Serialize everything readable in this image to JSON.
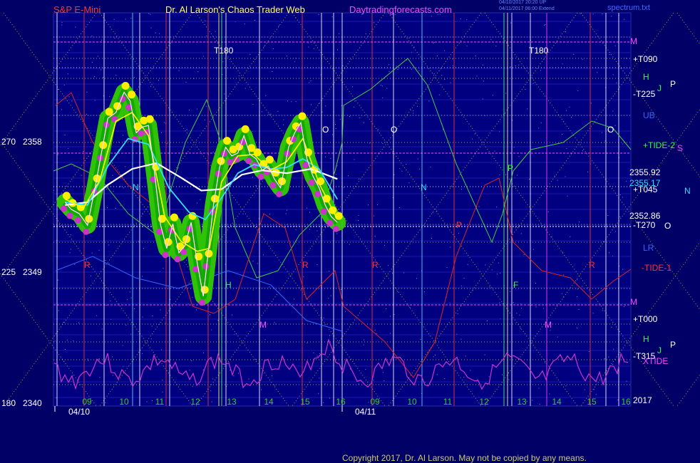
{
  "header": {
    "symbol": "S&P E-Mini",
    "site": "Dr. Al Larson's Chaos Trader Web",
    "url": "Daytradingforecasts.com",
    "stamp_line1": "04/10/2017 20:20 UP",
    "stamp_line2": "04/11/2017 06:00 Extend",
    "file": "spectrum.txt"
  },
  "copyright": "Copyright 2017, Dr. Al Larson. May not be copied by any means.",
  "colors": {
    "background": "#000066",
    "price_line": "#ffffff",
    "ma_fast": "#ffff00",
    "ma_mid": "#ff44ff",
    "ma_slow": "#33ddff",
    "ma_long": "#ffffff",
    "highlight_green": "#33cc00",
    "dot_yellow": "#ffee00",
    "dot_magenta": "#cc33cc",
    "tide": "#cc33cc",
    "red_flux": "#dd2222",
    "green_flux": "#44cc44"
  },
  "chart_data": {
    "type": "line",
    "title": "S&P E-Mini",
    "y_axis_labels": [
      {
        "angle": "270",
        "price": "2358"
      },
      {
        "angle": "225",
        "price": "2349"
      },
      {
        "angle": "180",
        "price": "2340"
      }
    ],
    "ylim": [
      2340,
      2365
    ],
    "dates": [
      "04/10",
      "04/11"
    ],
    "hour_ticks": [
      "09",
      "10",
      "11",
      "12",
      "13",
      "14",
      "15",
      "16",
      "09",
      "10",
      "11",
      "12",
      "13",
      "14",
      "15",
      "16"
    ],
    "price_levels": [
      {
        "label": "2355.92",
        "value": 2355.92
      },
      {
        "label": "2355.17",
        "value": 2355.17
      },
      {
        "label": "2352.86",
        "value": 2352.86
      }
    ],
    "right_labels": [
      "M",
      "+T090",
      "H",
      "-T225",
      "UB",
      "+TIDE-2",
      "+T045",
      "-T270",
      "LR",
      "-TIDE-1",
      "M",
      "+T000",
      "H",
      "-T315",
      "XTIDE",
      "2017"
    ],
    "far_right_letters": [
      "P",
      "S",
      "N",
      "O",
      "P"
    ],
    "markers": [
      "T180",
      "T180"
    ],
    "in_chart_letters": [
      "O",
      "O",
      "O",
      "N",
      "N",
      "P",
      "R",
      "R",
      "R",
      "R",
      "M",
      "M",
      "H",
      "F",
      "P",
      "J",
      "J"
    ],
    "price_series": [
      {
        "t": 8.95,
        "p": 2354.0
      },
      {
        "t": 9.1,
        "p": 2353.5
      },
      {
        "t": 9.3,
        "p": 2353.2
      },
      {
        "t": 9.5,
        "p": 2352.4
      },
      {
        "t": 9.7,
        "p": 2355.2
      },
      {
        "t": 9.85,
        "p": 2357.5
      },
      {
        "t": 10.0,
        "p": 2359.8
      },
      {
        "t": 10.2,
        "p": 2360.2
      },
      {
        "t": 10.4,
        "p": 2361.6
      },
      {
        "t": 10.55,
        "p": 2361.0
      },
      {
        "t": 10.7,
        "p": 2358.8
      },
      {
        "t": 10.85,
        "p": 2359.2
      },
      {
        "t": 11.0,
        "p": 2359.3
      },
      {
        "t": 11.15,
        "p": 2356.0
      },
      {
        "t": 11.3,
        "p": 2352.4
      },
      {
        "t": 11.45,
        "p": 2350.8
      },
      {
        "t": 11.6,
        "p": 2352.5
      },
      {
        "t": 11.75,
        "p": 2350.5
      },
      {
        "t": 11.9,
        "p": 2351.0
      },
      {
        "t": 12.05,
        "p": 2352.6
      },
      {
        "t": 12.2,
        "p": 2349.8
      },
      {
        "t": 12.35,
        "p": 2347.5
      },
      {
        "t": 12.45,
        "p": 2350.0
      },
      {
        "t": 12.6,
        "p": 2353.8
      },
      {
        "t": 12.75,
        "p": 2356.4
      },
      {
        "t": 12.9,
        "p": 2357.8
      },
      {
        "t": 13.05,
        "p": 2357.2
      },
      {
        "t": 13.2,
        "p": 2357.4
      },
      {
        "t": 13.35,
        "p": 2358.6
      },
      {
        "t": 13.5,
        "p": 2357.3
      },
      {
        "t": 13.65,
        "p": 2357.0
      },
      {
        "t": 13.8,
        "p": 2356.2
      },
      {
        "t": 13.95,
        "p": 2356.5
      },
      {
        "t": 14.1,
        "p": 2355.6
      },
      {
        "t": 14.25,
        "p": 2355.0
      },
      {
        "t": 14.45,
        "p": 2357.8
      },
      {
        "t": 14.6,
        "p": 2358.8
      },
      {
        "t": 14.75,
        "p": 2359.5
      },
      {
        "t": 14.9,
        "p": 2357.0
      },
      {
        "t": 15.05,
        "p": 2355.8
      },
      {
        "t": 15.2,
        "p": 2355.0
      },
      {
        "t": 15.35,
        "p": 2353.8
      },
      {
        "t": 15.5,
        "p": 2353.0
      },
      {
        "t": 15.65,
        "p": 2352.6
      }
    ],
    "ma_fast": [
      {
        "t": 8.95,
        "p": 2354.2
      },
      {
        "t": 9.4,
        "p": 2353.6
      },
      {
        "t": 9.8,
        "p": 2355.5
      },
      {
        "t": 10.2,
        "p": 2359.6
      },
      {
        "t": 10.6,
        "p": 2360.2
      },
      {
        "t": 11.0,
        "p": 2358.6
      },
      {
        "t": 11.4,
        "p": 2353.0
      },
      {
        "t": 11.8,
        "p": 2351.3
      },
      {
        "t": 12.2,
        "p": 2350.6
      },
      {
        "t": 12.5,
        "p": 2350.8
      },
      {
        "t": 12.8,
        "p": 2355.4
      },
      {
        "t": 13.2,
        "p": 2357.2
      },
      {
        "t": 13.6,
        "p": 2357.3
      },
      {
        "t": 14.0,
        "p": 2356.2
      },
      {
        "t": 14.4,
        "p": 2356.8
      },
      {
        "t": 14.8,
        "p": 2358.4
      },
      {
        "t": 15.2,
        "p": 2355.3
      },
      {
        "t": 15.65,
        "p": 2352.8
      }
    ],
    "ma_slow": [
      {
        "t": 8.95,
        "p": 2354.0
      },
      {
        "t": 9.5,
        "p": 2353.8
      },
      {
        "t": 10.0,
        "p": 2356.5
      },
      {
        "t": 10.5,
        "p": 2358.4
      },
      {
        "t": 11.0,
        "p": 2358.0
      },
      {
        "t": 11.5,
        "p": 2355.0
      },
      {
        "t": 12.0,
        "p": 2353.3
      },
      {
        "t": 12.4,
        "p": 2352.8
      },
      {
        "t": 12.8,
        "p": 2354.3
      },
      {
        "t": 13.2,
        "p": 2356.0
      },
      {
        "t": 13.6,
        "p": 2356.6
      },
      {
        "t": 14.0,
        "p": 2356.3
      },
      {
        "t": 14.4,
        "p": 2356.4
      },
      {
        "t": 14.8,
        "p": 2357.0
      },
      {
        "t": 15.2,
        "p": 2356.3
      },
      {
        "t": 15.65,
        "p": 2354.2
      }
    ],
    "ma_long": [
      {
        "t": 8.95,
        "p": 2353.8
      },
      {
        "t": 9.5,
        "p": 2354.0
      },
      {
        "t": 10.0,
        "p": 2355.2
      },
      {
        "t": 10.6,
        "p": 2356.3
      },
      {
        "t": 11.2,
        "p": 2356.7
      },
      {
        "t": 11.8,
        "p": 2355.7
      },
      {
        "t": 12.3,
        "p": 2354.8
      },
      {
        "t": 12.8,
        "p": 2354.9
      },
      {
        "t": 13.3,
        "p": 2355.9
      },
      {
        "t": 13.8,
        "p": 2356.2
      },
      {
        "t": 14.4,
        "p": 2356.0
      },
      {
        "t": 15.0,
        "p": 2356.3
      },
      {
        "t": 15.65,
        "p": 2355.6
      }
    ]
  }
}
